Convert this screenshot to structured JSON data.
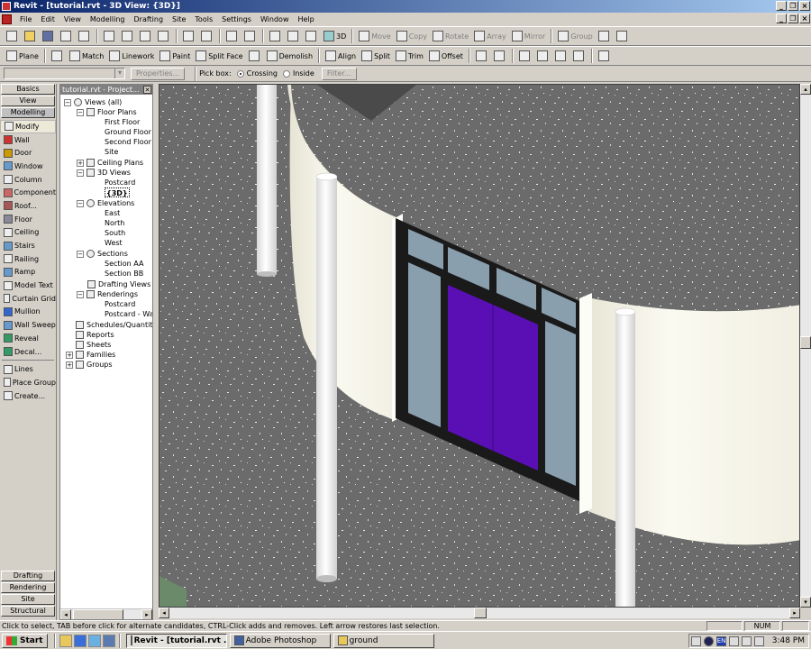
{
  "window": {
    "title": "Revit - [tutorial.rvt - 3D View: {3D}]"
  },
  "menu": [
    "File",
    "Edit",
    "View",
    "Modelling",
    "Drafting",
    "Site",
    "Tools",
    "Settings",
    "Window",
    "Help"
  ],
  "toolbar1": {
    "view3d": "3D",
    "move": "Move",
    "copy": "Copy",
    "rotate": "Rotate",
    "array": "Array",
    "mirror": "Mirror",
    "group": "Group"
  },
  "toolbar2": {
    "plane": "Plane",
    "match": "Match",
    "linework": "Linework",
    "paint": "Paint",
    "split_face": "Split Face",
    "demolish": "Demolish",
    "align": "Align",
    "split": "Split",
    "trim": "Trim",
    "offset": "Offset"
  },
  "options": {
    "properties": "Properties...",
    "pick_box": "Pick box:",
    "crossing": "Crossing",
    "inside": "Inside",
    "filter": "Filter..."
  },
  "designbar": {
    "tabs_top": [
      "Basics",
      "View",
      "Modelling"
    ],
    "items": [
      "Modify",
      "Wall",
      "Door",
      "Window",
      "Column",
      "Component",
      "Roof...",
      "Floor",
      "Ceiling",
      "Stairs",
      "Railing",
      "Ramp",
      "Model Text",
      "Curtain Grid",
      "Mullion",
      "Wall Sweep",
      "Reveal",
      "Decal...",
      "Lines",
      "Place Group",
      "Create..."
    ],
    "tabs_bottom": [
      "Drafting",
      "Rendering",
      "Site",
      "Structural"
    ]
  },
  "browser": {
    "title": "tutorial.rvt - Project...",
    "tree": {
      "views_all": "Views (all)",
      "floor_plans": "Floor Plans",
      "first_floor": "First Floor",
      "ground_floor": "Ground Floor",
      "second_floor": "Second Floor",
      "site": "Site",
      "ceiling_plans": "Ceiling Plans",
      "views_3d": "3D Views",
      "postcard": "Postcard",
      "view_3d": "{3D}",
      "elevations": "Elevations",
      "east": "East",
      "north": "North",
      "south": "South",
      "west": "West",
      "sections": "Sections",
      "section_aa": "Section AA",
      "section_bb": "Section BB",
      "drafting_views": "Drafting Views",
      "renderings": "Renderings",
      "render_postcard": "Postcard",
      "render_postcard_wall": "Postcard - Wall",
      "schedules": "Schedules/Quantities",
      "reports": "Reports",
      "sheets": "Sheets",
      "families": "Families",
      "groups": "Groups"
    }
  },
  "status": {
    "message": "Click to select, TAB before click for alternate candidates, CTRL-Click adds and removes. Left arrow restores last selection.",
    "num": "NUM"
  },
  "taskbar": {
    "start": "Start",
    "tasks": [
      "Revit - [tutorial.rvt ...",
      "Adobe Photoshop",
      "ground"
    ],
    "lang": "EN",
    "clock": "3:48 PM"
  },
  "colors": {
    "titlebar_start": "#0a246a",
    "door_panel": "#5a0fb5",
    "glass": "#8a9fae",
    "wall": "#f4f2e6",
    "floor": "#6e6e6e"
  }
}
